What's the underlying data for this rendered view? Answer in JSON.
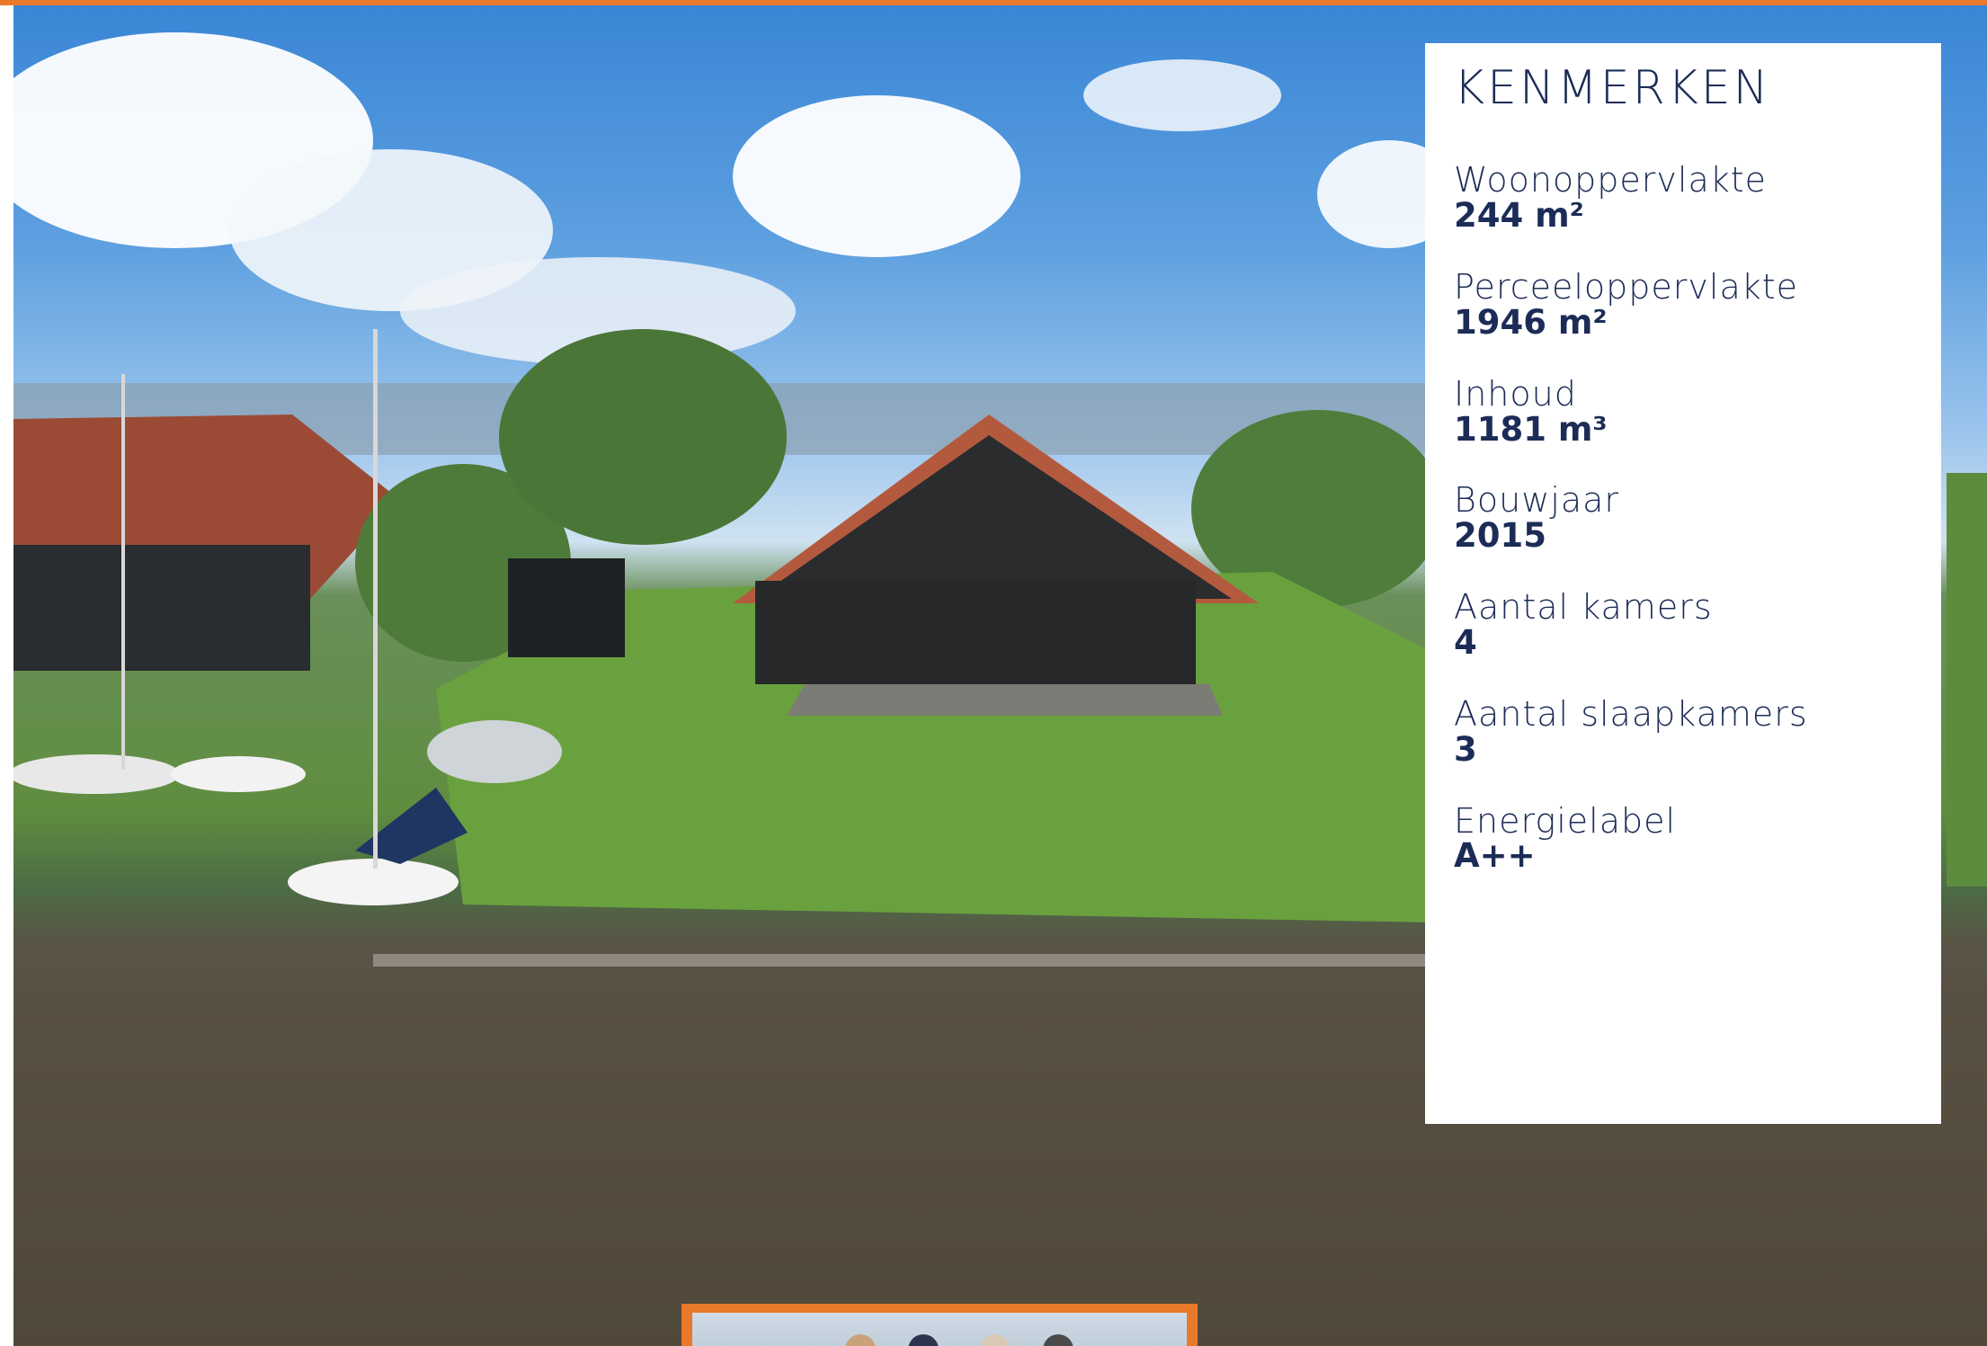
{
  "features": {
    "title": "KENMERKEN",
    "items": [
      {
        "label": "Woonoppervlakte",
        "value": "244 m²"
      },
      {
        "label": "Perceeloppervlakte",
        "value": "1946 m²"
      },
      {
        "label": "Inhoud",
        "value": "1181 m³"
      },
      {
        "label": "Bouwjaar",
        "value": "2015"
      },
      {
        "label": "Aantal kamers",
        "value": "4"
      },
      {
        "label": "Aantal slaapkamers",
        "value": "3"
      },
      {
        "label": "Energielabel",
        "value": "A++"
      }
    ]
  },
  "colors": {
    "accent": "#e97a2b",
    "text": "#1c2c57",
    "panel": "#ffffff"
  }
}
